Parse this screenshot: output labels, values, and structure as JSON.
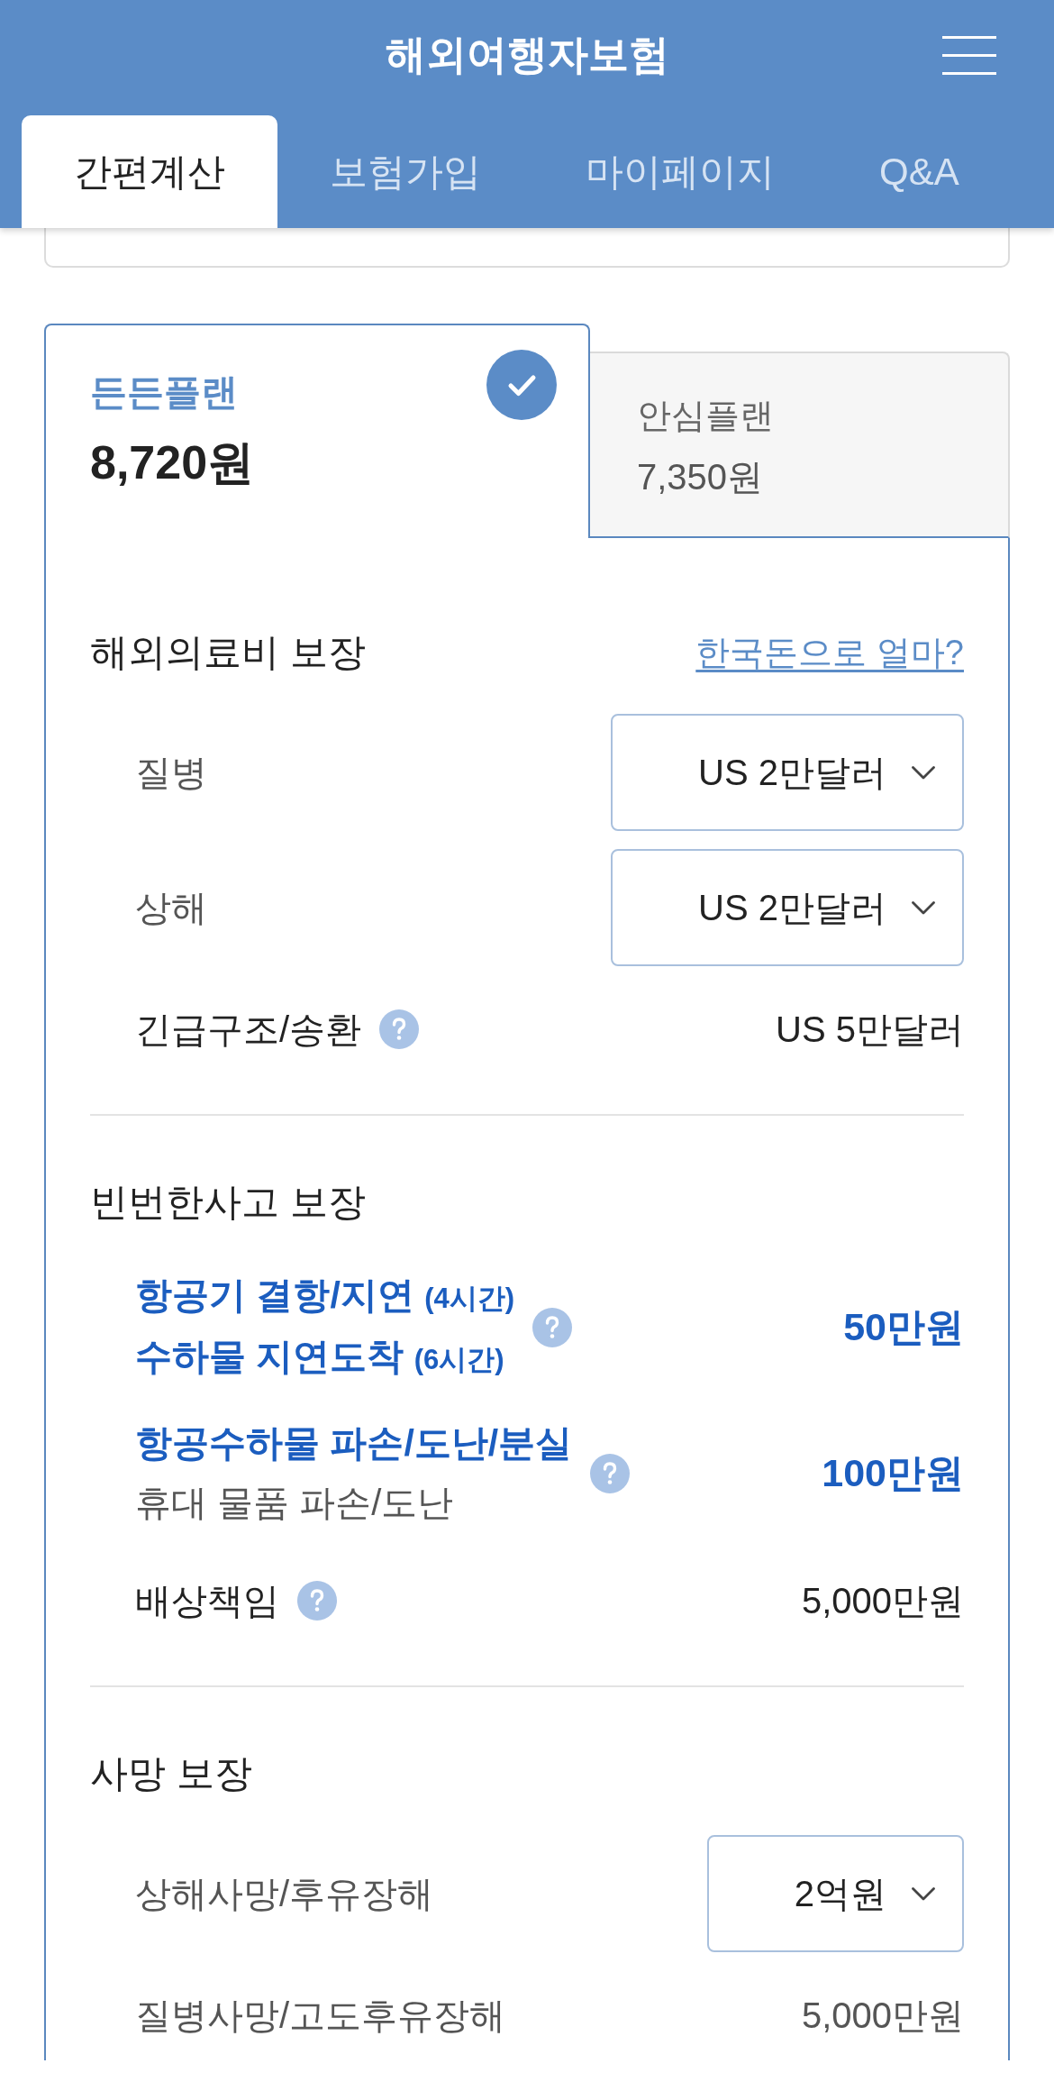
{
  "header": {
    "title": "해외여행자보험"
  },
  "tabs": [
    {
      "label": "간편계산",
      "selected": true
    },
    {
      "label": "보험가입",
      "selected": false
    },
    {
      "label": "마이페이지",
      "selected": false
    },
    {
      "label": "Q&A",
      "selected": false
    }
  ],
  "plans": [
    {
      "name": "든든플랜",
      "price": "8,720원",
      "selected": true
    },
    {
      "name": "안심플랜",
      "price": "7,350원",
      "selected": false
    }
  ],
  "sections": [
    {
      "title": "해외의료비 보장",
      "link": "한국돈으로 얼마?",
      "rows": [
        {
          "kind": "select",
          "label": "질병",
          "muted": true,
          "help": false,
          "value": "US 2만달러"
        },
        {
          "kind": "select",
          "label": "상해",
          "muted": true,
          "help": false,
          "value": "US 2만달러"
        },
        {
          "kind": "plain",
          "label": "긴급구조/송환",
          "muted": false,
          "help": true,
          "value": "US 5만달러"
        }
      ]
    },
    {
      "title": "빈번한사고 보장",
      "rows": [
        {
          "kind": "featured",
          "lines": [
            {
              "text": "항공기 결항/지연",
              "note": "(4시간)"
            },
            {
              "text": "수하물 지연도착",
              "note": "(6시간)"
            }
          ],
          "help": true,
          "value": "50만원"
        },
        {
          "kind": "featured",
          "lines": [
            {
              "text": "항공수하물 파손/도난/분실"
            }
          ],
          "sublabel": "휴대 물품 파손/도난",
          "help": true,
          "value": "100만원"
        },
        {
          "kind": "plain",
          "label": "배상책임",
          "muted": false,
          "help": true,
          "value": "5,000만원"
        }
      ]
    },
    {
      "title": "사망 보장",
      "rows": [
        {
          "kind": "select",
          "label": "상해사망/후유장해",
          "muted": true,
          "help": false,
          "value": "2억원"
        },
        {
          "kind": "plain",
          "label": "질병사망/고도후유장해",
          "muted": true,
          "help": false,
          "value": "5,000만원"
        }
      ]
    }
  ]
}
